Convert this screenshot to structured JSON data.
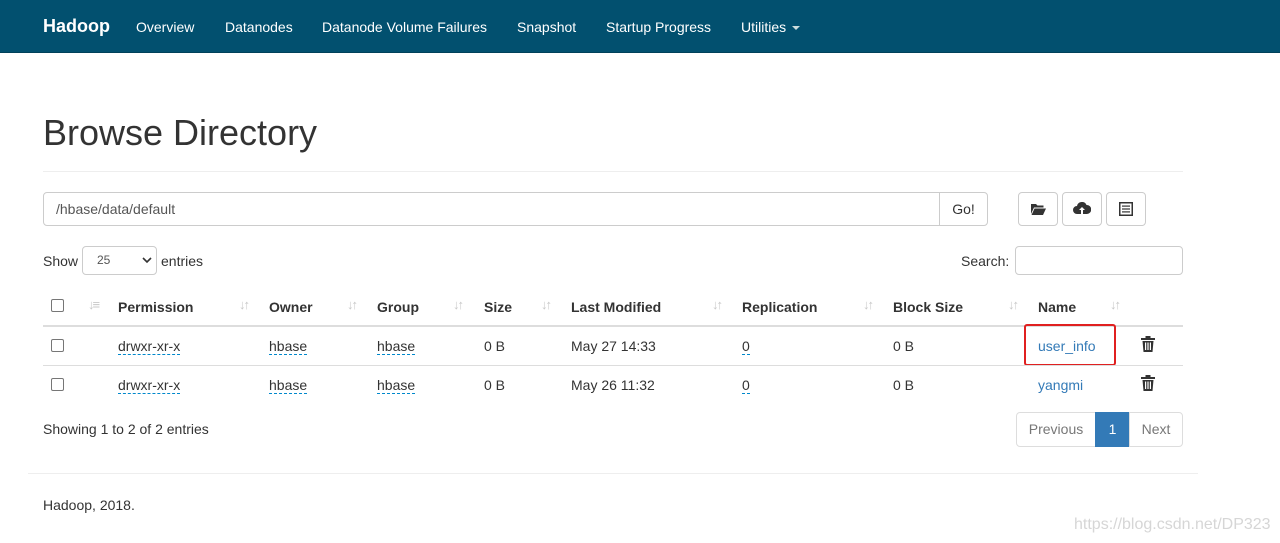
{
  "navbar": {
    "brand": "Hadoop",
    "items": [
      "Overview",
      "Datanodes",
      "Datanode Volume Failures",
      "Snapshot",
      "Startup Progress",
      "Utilities"
    ]
  },
  "page": {
    "title": "Browse Directory"
  },
  "path": {
    "value": "/hbase/data/default",
    "go_label": "Go!"
  },
  "toolbar": {
    "icons": [
      "folder-open-icon",
      "cloud-upload-icon",
      "list-alt-icon"
    ]
  },
  "entries": {
    "show_label": "Show",
    "value": "25",
    "suffix": "entries"
  },
  "search": {
    "label": "Search:"
  },
  "table": {
    "headers": [
      "Permission",
      "Owner",
      "Group",
      "Size",
      "Last Modified",
      "Replication",
      "Block Size",
      "Name"
    ],
    "rows": [
      {
        "permission": "drwxr-xr-x",
        "owner": "hbase",
        "group": "hbase",
        "size": "0 B",
        "modified": "May 27 14:33",
        "replication": "0",
        "block_size": "0 B",
        "name": "user_info"
      },
      {
        "permission": "drwxr-xr-x",
        "owner": "hbase",
        "group": "hbase",
        "size": "0 B",
        "modified": "May 26 11:32",
        "replication": "0",
        "block_size": "0 B",
        "name": "yangmi"
      }
    ]
  },
  "pagination": {
    "info": "Showing 1 to 2 of 2 entries",
    "previous": "Previous",
    "current": "1",
    "next": "Next"
  },
  "footer": {
    "text": "Hadoop, 2018."
  },
  "watermark": "https://blog.csdn.net/DP323",
  "colors": {
    "navbar": "#02506f",
    "link": "#337ab7",
    "active_page": "#337ab7",
    "highlight": "#e02020"
  }
}
